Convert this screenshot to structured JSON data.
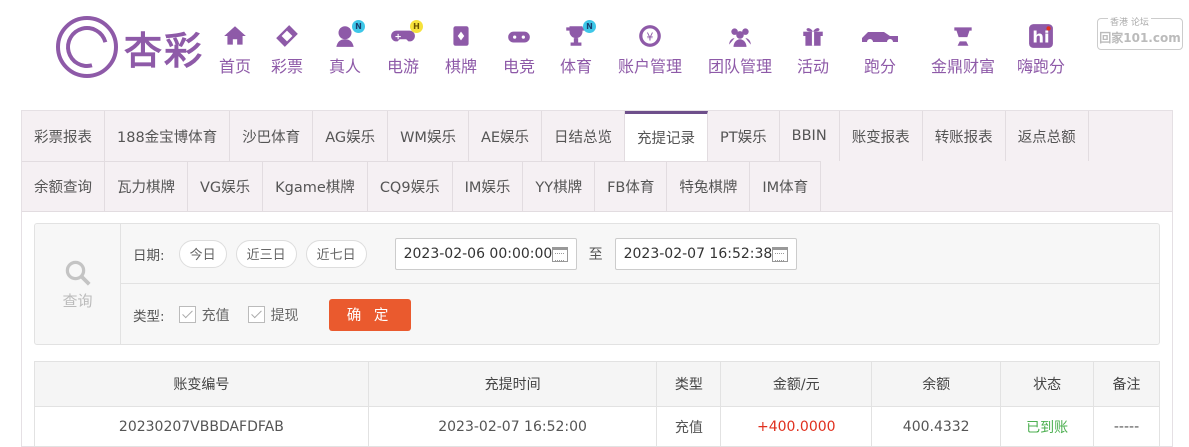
{
  "logo": {
    "text": "杏彩"
  },
  "watermark": {
    "top": "香港  论坛",
    "text": "回家101.com"
  },
  "nav": [
    {
      "label": "首页",
      "icon": "home-icon",
      "badge": ""
    },
    {
      "label": "彩票",
      "icon": "ticket-icon",
      "badge": ""
    },
    {
      "label": "真人",
      "icon": "dealer-icon",
      "badge": "N"
    },
    {
      "label": "电游",
      "icon": "gamepad-icon",
      "badge": "H"
    },
    {
      "label": "棋牌",
      "icon": "cards-icon",
      "badge": ""
    },
    {
      "label": "电竞",
      "icon": "esports-icon",
      "badge": ""
    },
    {
      "label": "体育",
      "icon": "trophy-icon",
      "badge": "N"
    },
    {
      "label": "账户管理",
      "icon": "coin-icon",
      "badge": ""
    },
    {
      "label": "团队管理",
      "icon": "team-icon",
      "badge": ""
    },
    {
      "label": "活动",
      "icon": "gift-icon",
      "badge": ""
    },
    {
      "label": "跑分",
      "icon": "car-icon",
      "badge": ""
    },
    {
      "label": "金鼎财富",
      "icon": "wealth-icon",
      "badge": ""
    },
    {
      "label": "嗨跑分",
      "icon": "hi-icon",
      "badge": ""
    }
  ],
  "tabs_row1": [
    "彩票报表",
    "188金宝博体育",
    "沙巴体育",
    "AG娱乐",
    "WM娱乐",
    "AE娱乐",
    "日结总览",
    "充提记录",
    "PT娱乐",
    "BBIN",
    "账变报表",
    "转账报表",
    "返点总额"
  ],
  "tabs_row2": [
    "余额查询",
    "瓦力棋牌",
    "VG娱乐",
    "Kgame棋牌",
    "CQ9娱乐",
    "IM娱乐",
    "YY棋牌",
    "FB体育",
    "特兔棋牌",
    "IM体育"
  ],
  "active_tab": "充提记录",
  "filter": {
    "search_label": "查询",
    "date_label": "日期:",
    "quick": [
      "今日",
      "近三日",
      "近七日"
    ],
    "start": "2023-02-06 00:00:00",
    "to": "至",
    "end": "2023-02-07 16:52:38",
    "type_label": "类型:",
    "types": [
      "充值",
      "提现"
    ],
    "confirm": "确 定"
  },
  "table": {
    "headers": [
      "账变编号",
      "充提时间",
      "类型",
      "金额/元",
      "余额",
      "状态",
      "备注"
    ],
    "rows": [
      [
        "20230207VBBDAFDFAB",
        "2023-02-07 16:52:00",
        "充值",
        "+400.0000",
        "400.4332",
        "已到账",
        "-----"
      ]
    ]
  },
  "colors": {
    "accent": "#8e5aa8",
    "confirm": "#ea5a2e",
    "amount": "#e0301e",
    "status": "#4caf50"
  }
}
